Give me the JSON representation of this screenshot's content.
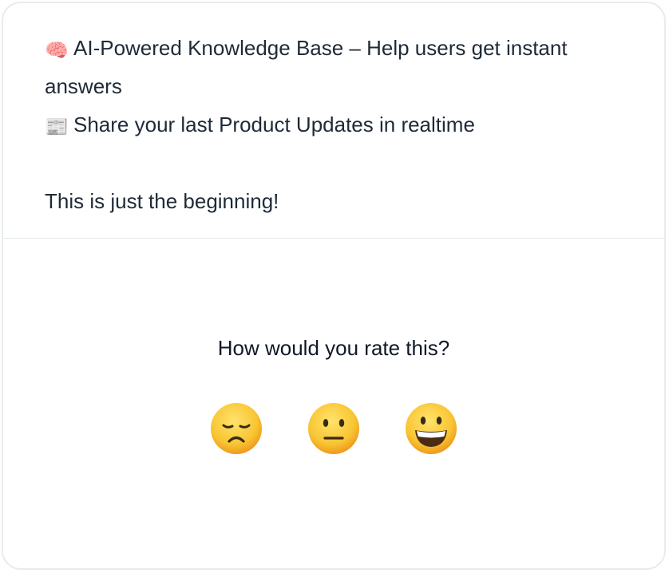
{
  "message": {
    "line1_icon": "brain-icon",
    "line1_glyph": "🧠",
    "line1_text": "AI-Powered Knowledge Base – Help users get instant answers",
    "line2_icon": "newspaper-icon",
    "line2_glyph": "📰",
    "line2_text": "Share your last Product Updates in realtime",
    "line3_text": "This is just the beginning!"
  },
  "rating": {
    "question": "How would you rate this?",
    "options": [
      {
        "icon": "disappointed-face-icon",
        "sentiment": "negative"
      },
      {
        "icon": "neutral-face-icon",
        "sentiment": "neutral"
      },
      {
        "icon": "grinning-face-icon",
        "sentiment": "positive"
      }
    ]
  },
  "colors": {
    "text": "#1f2a37",
    "border": "#e8ecef",
    "emoji_face": "#f6c234"
  }
}
